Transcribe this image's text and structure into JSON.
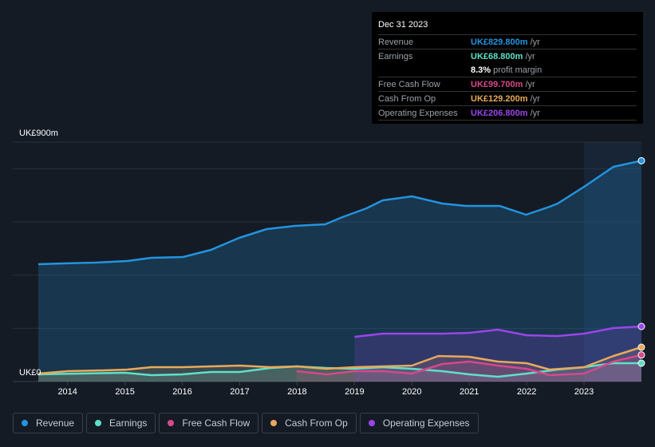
{
  "tooltip": {
    "date": "Dec 31 2023",
    "rows": [
      {
        "label": "Revenue",
        "value": "UK£829.800m",
        "unit": "/yr",
        "color": "#2394df"
      },
      {
        "label": "Earnings",
        "value": "UK£68.800m",
        "unit": "/yr",
        "color": "#5ee0c8"
      },
      {
        "label": "",
        "value": "8.3%",
        "unit": "profit margin",
        "color": "#ffffff"
      },
      {
        "label": "Free Cash Flow",
        "value": "UK£99.700m",
        "unit": "/yr",
        "color": "#d6488c"
      },
      {
        "label": "Cash From Op",
        "value": "UK£129.200m",
        "unit": "/yr",
        "color": "#e9a95b"
      },
      {
        "label": "Operating Expenses",
        "value": "UK£206.800m",
        "unit": "/yr",
        "color": "#9a45e8"
      }
    ]
  },
  "legend": [
    {
      "label": "Revenue",
      "color": "#2394df"
    },
    {
      "label": "Earnings",
      "color": "#5ee0c8"
    },
    {
      "label": "Free Cash Flow",
      "color": "#d6488c"
    },
    {
      "label": "Cash From Op",
      "color": "#e9a95b"
    },
    {
      "label": "Operating Expenses",
      "color": "#9a45e8"
    }
  ],
  "chart_data": {
    "type": "line",
    "title": "",
    "xlabel": "",
    "ylabel": "",
    "y_top_label": "UK£900m",
    "y_bottom_label": "UK£0",
    "ylim": [
      0,
      900
    ],
    "xlim": [
      2013.49,
      2024.0
    ],
    "highlight_from": 2023.0,
    "x_ticks": [
      "2014",
      "2015",
      "2016",
      "2017",
      "2018",
      "2019",
      "2020",
      "2021",
      "2022",
      "2023"
    ],
    "grid": true,
    "gridlines": [
      200,
      400,
      600,
      800,
      900
    ],
    "series": [
      {
        "name": "Revenue",
        "color": "#2394df",
        "x": [
          2013.49,
          2013.93,
          2014.49,
          2015.04,
          2015.46,
          2016.01,
          2016.5,
          2016.99,
          2017.47,
          2017.96,
          2018.49,
          2018.79,
          2019.21,
          2019.49,
          2020.0,
          2020.53,
          2020.94,
          2021.53,
          2021.99,
          2022.4,
          2022.54,
          2023.0,
          2023.51,
          2024.0
        ],
        "values": [
          441,
          444,
          447,
          453,
          465,
          468,
          495,
          540,
          573,
          585,
          591,
          618,
          651,
          681,
          696,
          669,
          660,
          660,
          627,
          657,
          669,
          732,
          807,
          830
        ]
      },
      {
        "name": "Earnings",
        "color": "#5ee0c8",
        "x": [
          2013.49,
          2014.21,
          2015.0,
          2015.46,
          2016.0,
          2016.5,
          2017.0,
          2017.54,
          2018.0,
          2018.51,
          2019.0,
          2019.49,
          2020.0,
          2020.53,
          2021.0,
          2021.5,
          2022.0,
          2022.54,
          2023.0,
          2023.51,
          2024.0
        ],
        "values": [
          27,
          30,
          33,
          24,
          27,
          36,
          36,
          51,
          57,
          51,
          48,
          54,
          48,
          39,
          27,
          18,
          30,
          45,
          54,
          69,
          69
        ]
      },
      {
        "name": "Free Cash Flow",
        "color": "#d6488c",
        "x": [
          2017.99,
          2018.51,
          2019.0,
          2019.49,
          2020.0,
          2020.53,
          2021.0,
          2021.5,
          2022.0,
          2022.4,
          2023.0,
          2023.51,
          2024.0
        ],
        "values": [
          39,
          27,
          39,
          39,
          30,
          66,
          75,
          60,
          48,
          24,
          30,
          75,
          100
        ]
      },
      {
        "name": "Cash From Op",
        "color": "#e9a95b",
        "x": [
          2013.49,
          2014.0,
          2014.63,
          2015.04,
          2015.46,
          2016.0,
          2016.5,
          2017.0,
          2017.54,
          2018.0,
          2018.51,
          2019.0,
          2019.49,
          2020.0,
          2020.46,
          2021.0,
          2021.5,
          2022.0,
          2022.4,
          2023.0,
          2023.51,
          2024.0
        ],
        "values": [
          30,
          39,
          42,
          45,
          54,
          54,
          57,
          60,
          54,
          57,
          48,
          54,
          57,
          60,
          96,
          93,
          75,
          69,
          45,
          54,
          96,
          129
        ]
      },
      {
        "name": "Operating Expenses",
        "color": "#9a45e8",
        "x": [
          2019.0,
          2019.49,
          2020.0,
          2020.53,
          2021.0,
          2021.5,
          2022.0,
          2022.54,
          2023.0,
          2023.51,
          2024.0
        ],
        "values": [
          168,
          180,
          180,
          180,
          183,
          195,
          174,
          171,
          180,
          201,
          207
        ]
      }
    ]
  }
}
